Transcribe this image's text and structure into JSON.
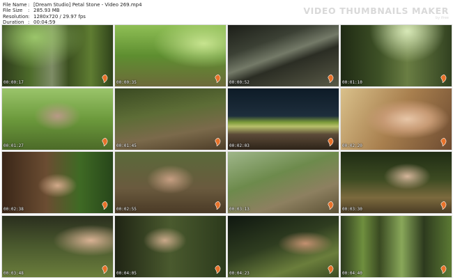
{
  "file_info": {
    "rows": [
      {
        "key": "File Name",
        "value": "[Dream Studio] Petal Stone - Video 269.mp4"
      },
      {
        "key": "File Size",
        "value": "285.93 MB"
      },
      {
        "key": "Resolution",
        "value": "1280x720 / 29.97 fps"
      },
      {
        "key": "Duration",
        "value": "00:04:59"
      }
    ]
  },
  "branding": {
    "title": "VIDEO THUMBNAILS MAKER",
    "subtitle": "by ifree"
  },
  "thumbnails": [
    {
      "time": "00:00:17",
      "scene": "forest-trees"
    },
    {
      "time": "00:00:35",
      "scene": "legs-forest"
    },
    {
      "time": "00:00:52",
      "scene": "fallen-log"
    },
    {
      "time": "00:01:10",
      "scene": "tree-walk"
    },
    {
      "time": "00:01:27",
      "scene": "blonde-woman"
    },
    {
      "time": "00:01:45",
      "scene": "legs-slope"
    },
    {
      "time": "00:02:03",
      "scene": "moss-log"
    },
    {
      "time": "00:02:20",
      "scene": "face-closeup"
    },
    {
      "time": "00:02:38",
      "scene": "hand-fern"
    },
    {
      "time": "00:02:55",
      "scene": "woman-sitting"
    },
    {
      "time": "00:03:13",
      "scene": "slope-walk"
    },
    {
      "time": "00:03:30",
      "scene": "crouching"
    },
    {
      "time": "00:03:48",
      "scene": "arm-branch"
    },
    {
      "time": "00:04:05",
      "scene": "woman-portrait"
    },
    {
      "time": "00:04:23",
      "scene": "woman-standing"
    },
    {
      "time": "00:04:40",
      "scene": "tall-forest"
    }
  ],
  "colors": {
    "brand_watermark": "#d9d9d9",
    "timestamp": "#ffffff",
    "background": "#ffffff"
  }
}
